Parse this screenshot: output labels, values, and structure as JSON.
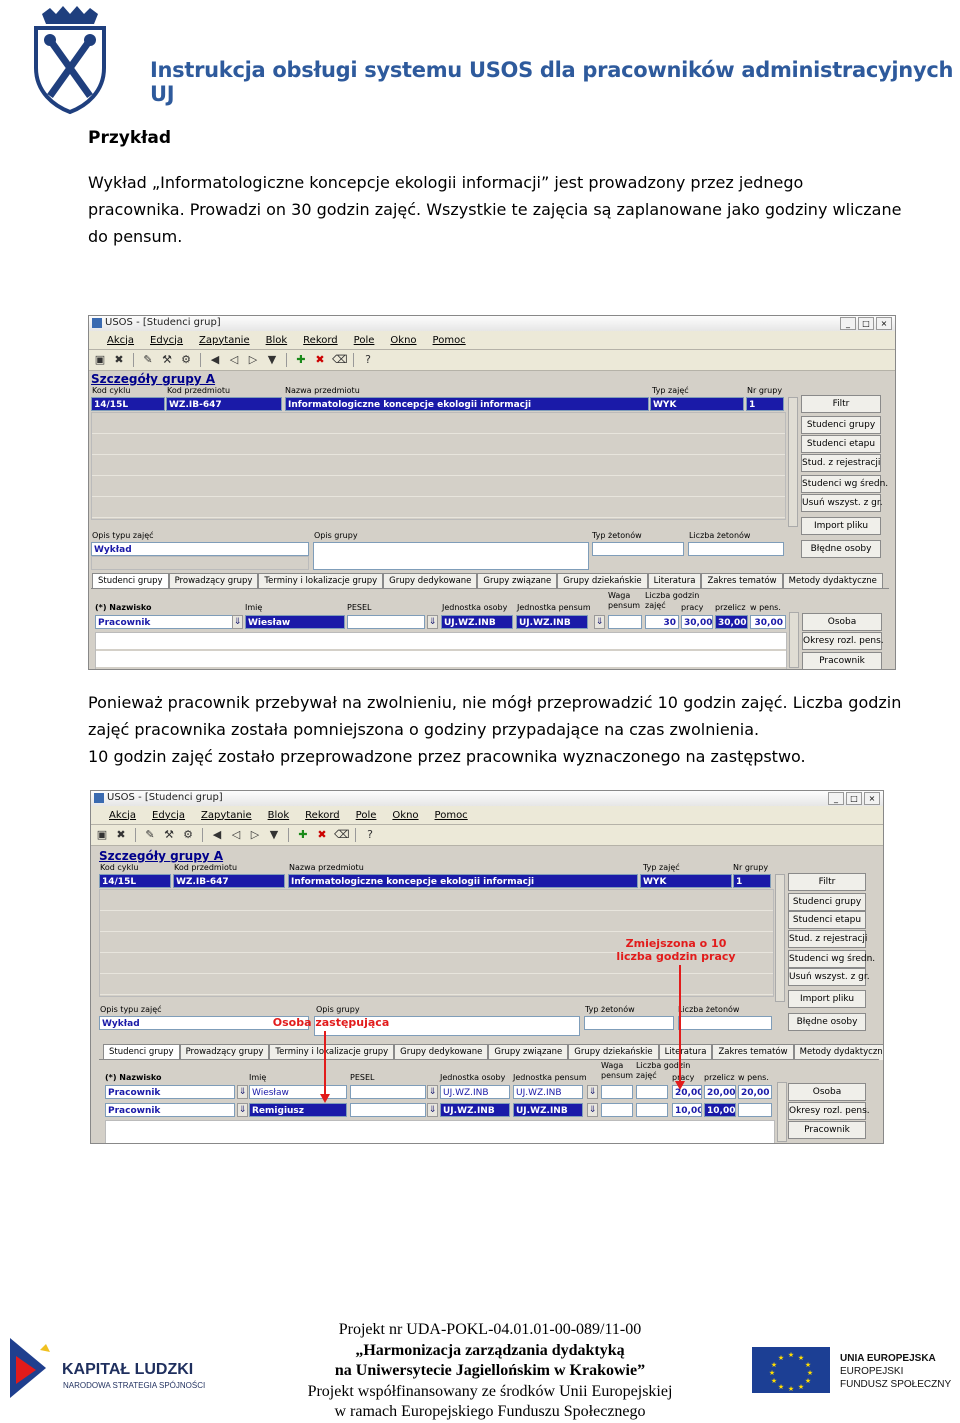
{
  "header": {
    "title": "Instrukcja obsługi systemu USOS dla pracowników administracyjnych UJ"
  },
  "heading": "Przykład",
  "intro_lines": [
    "Wykład „Informatologiczne koncepcje ekologii informacji” jest prowadzony przez jednego",
    "pracownika. Prowadzi on 30 godzin zajęć. Wszystkie te zajęcia są zaplanowane jako godziny wliczane",
    "do pensum."
  ],
  "middle_lines": [
    "Ponieważ pracownik przebywał na zwolnieniu, nie mógł przeprowadzić 10 godzin zajęć. Liczba godzin",
    "zajęć pracownika została pomniejszona o godziny przypadające na czas zwolnienia.",
    "10 godzin zajęć zostało przeprowadzone przez pracownika wyznaczonego na zastępstwo."
  ],
  "app": {
    "window_title": "USOS - [Studenci grup]",
    "menu": [
      "Akcja",
      "Edycja",
      "Zapytanie",
      "Blok",
      "Rekord",
      "Pole",
      "Okno",
      "Pomoc"
    ],
    "section_title": "Szczegóły grupy A",
    "labels": {
      "kod_cyklu": "Kod cyklu",
      "kod_przedmiotu": "Kod przedmiotu",
      "nazwa_przedmiotu": "Nazwa przedmiotu",
      "typ_zajec": "Typ zajęć",
      "nr_grupy": "Nr grupy",
      "opis_typu_zajec": "Opis typu zajęć",
      "opis_grupy": "Opis grupy",
      "typ_zetonow": "Typ żetonów",
      "liczba_zetonow": "Liczba żetonów",
      "nazwisko": "(*) Nazwisko",
      "imie": "Imię",
      "pesel": "PESEL",
      "jednostka_osoby": "Jednostka osoby",
      "jednostka_pensum": "Jednostka pensum",
      "waga_pensum": "Waga pensum",
      "liczba_godzin_zajec": "Liczba godzin zajęć",
      "pracy": "pracy",
      "przelicz": "przelicz",
      "w_pens": "w pens."
    },
    "values": {
      "kod_cyklu": "14/15L",
      "kod_przedmiotu": "WZ.IB-647",
      "nazwa_przedmiotu": "Informatologiczne koncepcje ekologii informacji",
      "typ_zajec": "WYK",
      "nr_grupy": "1",
      "opis_typu_zajec": "Wykład"
    },
    "side_buttons_top": [
      "Filtr",
      "Studenci grupy",
      "Studenci etapu",
      "Stud. z rejestracji",
      "Studenci wg średn.",
      "Usuń wszyst. z gr.",
      "Import pliku",
      "Błędne osoby"
    ],
    "tabs": [
      "Studenci grupy",
      "Prowadzący grupy",
      "Terminy i lokalizacje grupy",
      "Grupy dedykowane",
      "Grupy związane",
      "Grupy dziekańskie",
      "Literatura",
      "Zakres tematów",
      "Metody dydaktyczne"
    ],
    "side_buttons_bottom": [
      "Osoba",
      "Okresy rozl. pens.",
      "Pracownik"
    ]
  },
  "shot1": {
    "rows": [
      {
        "nazwisko": "Pracownik",
        "imie": "Wiesław",
        "jednostka_osoby": "UJ.WZ.INB",
        "jednostka_pensum": "UJ.WZ.INB",
        "liczba_godzin": "30",
        "pracy": "30,00",
        "przelicz": "30,00",
        "w_pens": "30,00"
      }
    ]
  },
  "shot2": {
    "rows": [
      {
        "nazwisko": "Pracownik",
        "imie": "Wiesław",
        "jednostka_osoby": "UJ.WZ.INB",
        "jednostka_pensum": "UJ.WZ.INB",
        "pracy": "20,00",
        "przelicz": "20,00",
        "w_pens": "20,00"
      },
      {
        "nazwisko": "Pracownik",
        "imie": "Remigiusz",
        "jednostka_osoby": "UJ.WZ.INB",
        "jednostka_pensum": "UJ.WZ.INB",
        "pracy": "10,00",
        "przelicz": "10,00",
        "w_pens": ""
      }
    ],
    "annotations": {
      "substitute": "Osoba zastępująca",
      "reduced_line1": "Zmiejszona o 10",
      "reduced_line2": "liczba godzin pracy"
    }
  },
  "footer": {
    "line1": "Projekt nr UDA-POKL-04.01.01-00-089/11-00",
    "line2": "„Harmonizacja zarządzania dydaktyką",
    "line3": "na Uniwersytecie Jagiellońskim w Krakowie”",
    "line4": "Projekt współfinansowany ze środków Unii Europejskiej",
    "line5": "w ramach Europejskiego Funduszu Społecznego"
  },
  "logos": {
    "kl_title": "KAPITAŁ LUDZKI",
    "kl_sub": "NARODOWA STRATEGIA SPÓJNOŚCI",
    "ue_line1": "UNIA EUROPEJSKA",
    "ue_line2": "EUROPEJSKI",
    "ue_line3": "FUNDUSZ SPOŁECZNY"
  },
  "colors": {
    "title_blue": "#2e5a9c",
    "selection_blue": "#1a1aa8",
    "annotation_red": "#e21b1b"
  }
}
